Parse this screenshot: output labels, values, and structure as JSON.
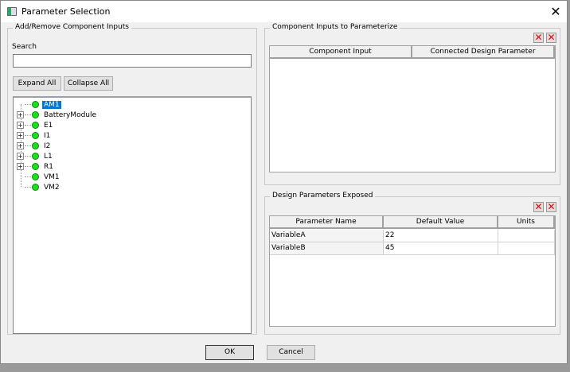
{
  "window": {
    "title": "Parameter Selection",
    "close": "✕"
  },
  "left": {
    "group_title": "Add/Remove Component Inputs",
    "search_label": "Search",
    "search_value": "",
    "expand_all": "Expand All",
    "collapse_all": "Collapse All",
    "tree": [
      {
        "label": "AM1",
        "expandable": false,
        "selected": true
      },
      {
        "label": "BatteryModule",
        "expandable": true
      },
      {
        "label": "E1",
        "expandable": true
      },
      {
        "label": "I1",
        "expandable": true
      },
      {
        "label": "I2",
        "expandable": true
      },
      {
        "label": "L1",
        "expandable": true
      },
      {
        "label": "R1",
        "expandable": true
      },
      {
        "label": "VM1",
        "expandable": false
      },
      {
        "label": "VM2",
        "expandable": false
      }
    ]
  },
  "inputs_panel": {
    "group_title": "Component Inputs to Parameterize",
    "columns": [
      "Component Input",
      "Connected Design Parameter"
    ],
    "rows": []
  },
  "params_panel": {
    "group_title": "Design Parameters Exposed",
    "columns": [
      "Parameter Name",
      "Default Value",
      "Units"
    ],
    "rows": [
      [
        "VariableA",
        "22",
        ""
      ],
      [
        "VariableB",
        "45",
        ""
      ]
    ]
  },
  "footer": {
    "ok": "OK",
    "cancel": "Cancel"
  },
  "icons": {
    "delete": "✕",
    "delete_all": "✕"
  }
}
